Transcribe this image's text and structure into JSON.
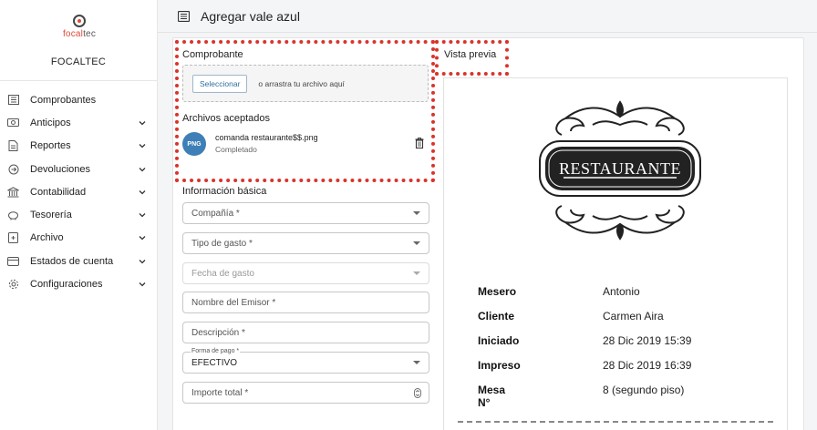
{
  "app": {
    "logo_part1": "focal",
    "logo_part2": "tec",
    "company_name": "FOCALTEC",
    "accent_color": "#e04a3a",
    "highlight_color": "#d9342b"
  },
  "sidebar": {
    "items": [
      {
        "label": "Comprobantes",
        "icon": "document-list-icon",
        "expandable": false
      },
      {
        "label": "Anticipos",
        "icon": "money-icon",
        "expandable": true
      },
      {
        "label": "Reportes",
        "icon": "report-icon",
        "expandable": true
      },
      {
        "label": "Devoluciones",
        "icon": "refund-icon",
        "expandable": true
      },
      {
        "label": "Contabilidad",
        "icon": "bank-icon",
        "expandable": true
      },
      {
        "label": "Tesorería",
        "icon": "piggy-bank-icon",
        "expandable": true
      },
      {
        "label": "Archivo",
        "icon": "archive-icon",
        "expandable": true
      },
      {
        "label": "Estados de cuenta",
        "icon": "account-statement-icon",
        "expandable": true
      },
      {
        "label": "Configuraciones",
        "icon": "gear-icon",
        "expandable": true
      }
    ]
  },
  "header": {
    "title": "Agregar vale azul"
  },
  "upload": {
    "title": "Comprobante",
    "select_label": "Seleccionar",
    "drop_text": "o arrastra tu archivo aquí",
    "accepted_title": "Archivos aceptados",
    "file": {
      "badge": "PNG",
      "name": "comanda restaurante$$.png",
      "status": "Completado"
    }
  },
  "form": {
    "title": "Información básica",
    "fields": {
      "company": "Compañía *",
      "expense_type": "Tipo de gasto *",
      "expense_date": "Fecha de gasto",
      "issuer_name": "Nombre del Emisor *",
      "description": "Descripción *",
      "payment_label": "Forma de pago *",
      "payment_value": "EFECTIVO",
      "total": "Importe total *"
    }
  },
  "preview": {
    "title": "Vista previa",
    "logo_text": "RESTAURANTE",
    "rows": [
      {
        "key": "Mesero",
        "value": "Antonio"
      },
      {
        "key": "Cliente",
        "value": "Carmen Aira"
      },
      {
        "key": "Iniciado",
        "value": "28 Dic 2019 15:39"
      },
      {
        "key": "Impreso",
        "value": "28 Dic 2019 16:39"
      },
      {
        "key": "Mesa N°",
        "value": "8 (segundo piso)"
      }
    ]
  }
}
